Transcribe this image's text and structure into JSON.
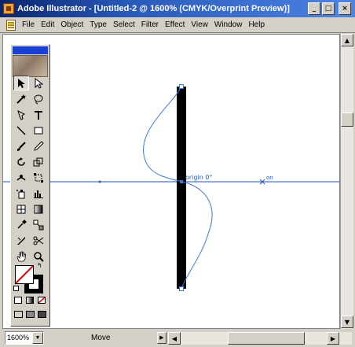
{
  "window": {
    "title": "Adobe Illustrator - [Untitled-2 @ 1600% (CMYK/Overprint Preview)]",
    "controls": {
      "minimize": "_",
      "maximize": "□",
      "close": "×"
    }
  },
  "menubar": {
    "items": [
      "File",
      "Edit",
      "Object",
      "Type",
      "Select",
      "Filter",
      "Effect",
      "View",
      "Window",
      "Help"
    ],
    "doc_controls": {
      "minimize": "_",
      "restore": "❐",
      "close": "×"
    }
  },
  "canvas": {
    "guide_label_origin": "origin 0°",
    "guide_label_on": "on"
  },
  "statusbar": {
    "zoom": "1600%",
    "current_tool": "Move"
  },
  "toolbox": {
    "tools": [
      "selection-tool",
      "direct-selection-tool",
      "magic-wand-tool",
      "lasso-tool",
      "pen-tool",
      "type-tool",
      "line-segment-tool",
      "rectangle-tool",
      "paintbrush-tool",
      "pencil-tool",
      "rotate-tool",
      "scale-tool",
      "warp-tool",
      "free-transform-tool",
      "symbol-sprayer-tool",
      "column-graph-tool",
      "mesh-tool",
      "gradient-tool",
      "eyedropper-tool",
      "blend-tool",
      "slice-tool",
      "scissors-tool",
      "hand-tool",
      "zoom-tool"
    ]
  },
  "colors": {
    "title_bar": "#0a246a",
    "guide_line": "#1e55b8",
    "selected_path": "#3a7bd5",
    "rectangle_fill": "#000000",
    "toolbox_header": "#1a3fd6"
  }
}
